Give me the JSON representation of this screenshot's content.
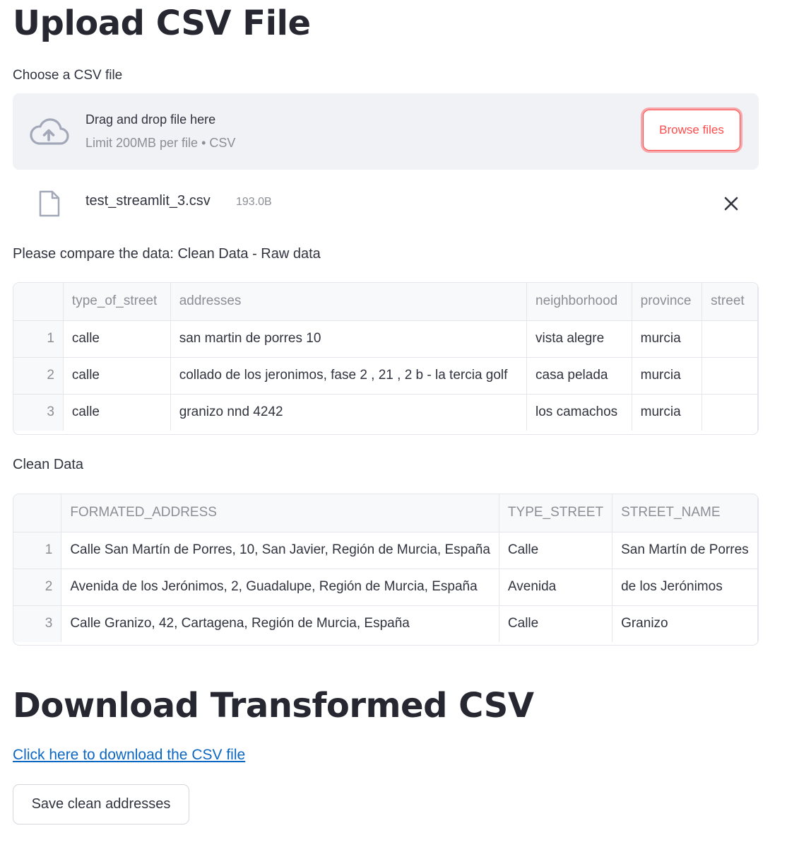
{
  "upload": {
    "title": "Upload CSV File",
    "label": "Choose a CSV file",
    "drag_text": "Drag and drop file here",
    "limit_text": "Limit 200MB per file • CSV",
    "browse_label": "Browse files",
    "file_name": "test_streamlit_3.csv",
    "file_size": "193.0B"
  },
  "compare": {
    "label": "Please compare the data: Clean Data - Raw data",
    "columns": [
      "",
      "type_of_street",
      "addresses",
      "neighborhood",
      "province",
      "street"
    ],
    "rows": [
      [
        "1",
        "calle",
        "san martin de porres  10",
        "vista alegre",
        "murcia",
        ""
      ],
      [
        "2",
        "calle",
        "collado de los jeronimos, fase  2 ,  21 ,  2 b - la tercia golf",
        "casa pelada",
        "murcia",
        ""
      ],
      [
        "3",
        "calle",
        "granizo nnd 4242",
        "los camachos",
        "murcia",
        ""
      ]
    ]
  },
  "clean": {
    "label": "Clean Data",
    "columns": [
      "",
      "FORMATED_ADDRESS",
      "TYPE_STREET",
      "STREET_NAME"
    ],
    "rows": [
      [
        "1",
        "Calle San Martín de Porres, 10, San Javier, Región de Murcia, España",
        "Calle",
        "San Martín de Porres"
      ],
      [
        "2",
        "Avenida de los Jerónimos, 2, Guadalupe, Región de Murcia, España",
        "Avenida",
        "de los Jerónimos"
      ],
      [
        "3",
        "Calle Granizo, 42, Cartagena, Región de Murcia, España",
        "Calle",
        "Granizo"
      ]
    ]
  },
  "download": {
    "title": "Download Transformed CSV",
    "link_text": "Click here to download the CSV file",
    "save_label": "Save clean addresses"
  },
  "icons": {
    "upload": "cloud-upload-icon",
    "file": "file-icon",
    "close": "close-icon"
  },
  "colors": {
    "accent": "#ff4b4b",
    "link": "#0b67c2",
    "dropzone_bg": "#f0f2f6",
    "muted_text": "#8c8e96"
  }
}
